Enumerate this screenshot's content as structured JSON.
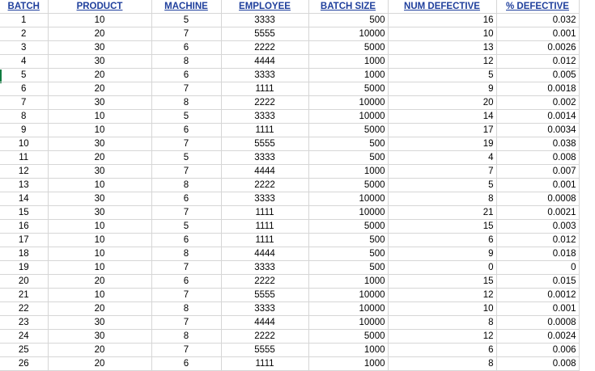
{
  "headers": [
    "BATCH",
    "PRODUCT",
    "MACHINE",
    "EMPLOYEE",
    "BATCH SIZE",
    "NUM DEFECTIVE",
    "% DEFECTIVE"
  ],
  "rows": [
    [
      "1",
      "10",
      "5",
      "3333",
      "500",
      "16",
      "0.032"
    ],
    [
      "2",
      "20",
      "7",
      "5555",
      "10000",
      "10",
      "0.001"
    ],
    [
      "3",
      "30",
      "6",
      "2222",
      "5000",
      "13",
      "0.0026"
    ],
    [
      "4",
      "30",
      "8",
      "4444",
      "1000",
      "12",
      "0.012"
    ],
    [
      "5",
      "20",
      "6",
      "3333",
      "1000",
      "5",
      "0.005"
    ],
    [
      "6",
      "20",
      "7",
      "1111",
      "5000",
      "9",
      "0.0018"
    ],
    [
      "7",
      "30",
      "8",
      "2222",
      "10000",
      "20",
      "0.002"
    ],
    [
      "8",
      "10",
      "5",
      "3333",
      "10000",
      "14",
      "0.0014"
    ],
    [
      "9",
      "10",
      "6",
      "1111",
      "5000",
      "17",
      "0.0034"
    ],
    [
      "10",
      "30",
      "7",
      "5555",
      "500",
      "19",
      "0.038"
    ],
    [
      "11",
      "20",
      "5",
      "3333",
      "500",
      "4",
      "0.008"
    ],
    [
      "12",
      "30",
      "7",
      "4444",
      "1000",
      "7",
      "0.007"
    ],
    [
      "13",
      "10",
      "8",
      "2222",
      "5000",
      "5",
      "0.001"
    ],
    [
      "14",
      "30",
      "6",
      "3333",
      "10000",
      "8",
      "0.0008"
    ],
    [
      "15",
      "30",
      "7",
      "1111",
      "10000",
      "21",
      "0.0021"
    ],
    [
      "16",
      "10",
      "5",
      "1111",
      "5000",
      "15",
      "0.003"
    ],
    [
      "17",
      "10",
      "6",
      "1111",
      "500",
      "6",
      "0.012"
    ],
    [
      "18",
      "10",
      "8",
      "4444",
      "500",
      "9",
      "0.018"
    ],
    [
      "19",
      "10",
      "7",
      "3333",
      "500",
      "0",
      "0"
    ],
    [
      "20",
      "20",
      "6",
      "2222",
      "1000",
      "15",
      "0.015"
    ],
    [
      "21",
      "10",
      "7",
      "5555",
      "10000",
      "12",
      "0.0012"
    ],
    [
      "22",
      "20",
      "8",
      "3333",
      "10000",
      "10",
      "0.001"
    ],
    [
      "23",
      "30",
      "7",
      "4444",
      "10000",
      "8",
      "0.0008"
    ],
    [
      "24",
      "30",
      "8",
      "2222",
      "5000",
      "12",
      "0.0024"
    ],
    [
      "25",
      "20",
      "7",
      "5555",
      "1000",
      "6",
      "0.006"
    ],
    [
      "26",
      "20",
      "6",
      "1111",
      "1000",
      "8",
      "0.008"
    ]
  ]
}
